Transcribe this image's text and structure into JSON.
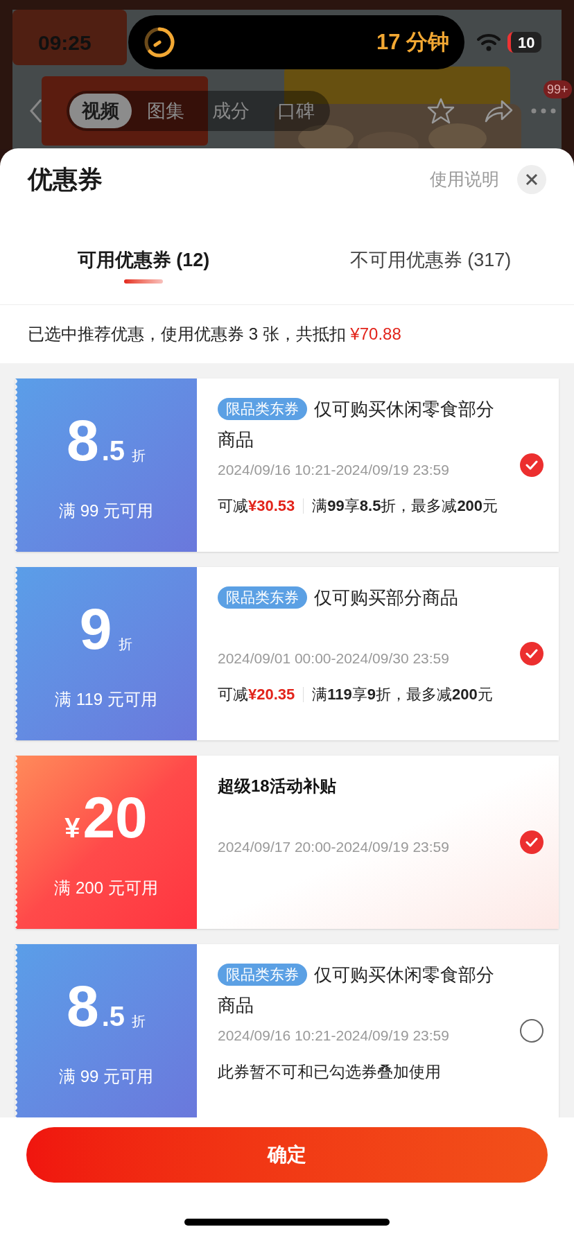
{
  "status_bar": {
    "time": "09:25",
    "activity": "17 分钟",
    "battery": "10"
  },
  "product_nav": {
    "tabs": [
      {
        "label": "视频",
        "selected": true
      },
      {
        "label": "图集",
        "selected": false
      },
      {
        "label": "成分",
        "selected": false
      },
      {
        "label": "口碑",
        "selected": false
      }
    ],
    "badge": "99+"
  },
  "sheet": {
    "title": "优惠券",
    "help_link": "使用说明",
    "tabs": [
      {
        "label": "可用优惠券 (12)",
        "selected": true
      },
      {
        "label": "不可用优惠券 (317)",
        "selected": false
      }
    ],
    "summary": {
      "text": "已选中推荐优惠，使用优惠券 3 张，共抵扣",
      "amount": "¥70.88"
    },
    "coupons": [
      {
        "kind": "category",
        "value": {
          "main": "8",
          "decimal": ".5",
          "unit": "折"
        },
        "condition": "满 99 元可用",
        "tag": "限品类东券",
        "description": "仅可购买休闲零食部分商品",
        "validity": "2024/09/16 10:21-2024/09/19 23:59",
        "saving_label": "可减",
        "saving_amount": "¥30.53",
        "rule": "满**99**享**8.5**折，最多减**200**元",
        "selected": true
      },
      {
        "kind": "category",
        "value": {
          "main": "9",
          "unit": "折"
        },
        "condition": "满 119 元可用",
        "tag": "限品类东券",
        "description": "仅可购买部分商品",
        "validity": "2024/09/01 00:00-2024/09/30 23:59",
        "saving_label": "可减",
        "saving_amount": "¥20.35",
        "rule": "满**119**享**9**折，最多减**200**元",
        "selected": true
      },
      {
        "kind": "subsidy",
        "value": {
          "symbol": "¥",
          "main": "20"
        },
        "condition": "满 200 元可用",
        "title": "超级18活动补贴",
        "validity": "2024/09/17 20:00-2024/09/19 23:59",
        "selected": true
      },
      {
        "kind": "category",
        "value": {
          "main": "8",
          "decimal": ".5",
          "unit": "折"
        },
        "condition": "满 99 元可用",
        "tag": "限品类东券",
        "description": "仅可购买休闲零食部分商品",
        "validity": "2024/09/16 10:21-2024/09/19 23:59",
        "note": "此券暂不可和已勾选券叠加使用",
        "selected": false
      }
    ],
    "confirm_button": "确定"
  }
}
